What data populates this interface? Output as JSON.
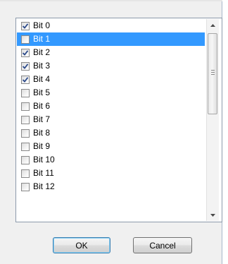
{
  "list": {
    "items": [
      {
        "label": "Bit 0",
        "checked": true,
        "selected": false
      },
      {
        "label": "Bit 1",
        "checked": false,
        "selected": true
      },
      {
        "label": "Bit 2",
        "checked": true,
        "selected": false
      },
      {
        "label": "Bit 3",
        "checked": true,
        "selected": false
      },
      {
        "label": "Bit 4",
        "checked": true,
        "selected": false
      },
      {
        "label": "Bit 5",
        "checked": false,
        "selected": false
      },
      {
        "label": "Bit 6",
        "checked": false,
        "selected": false
      },
      {
        "label": "Bit 7",
        "checked": false,
        "selected": false
      },
      {
        "label": "Bit 8",
        "checked": false,
        "selected": false
      },
      {
        "label": "Bit 9",
        "checked": false,
        "selected": false
      },
      {
        "label": "Bit 10",
        "checked": false,
        "selected": false
      },
      {
        "label": "Bit 11",
        "checked": false,
        "selected": false
      },
      {
        "label": "Bit 12",
        "checked": false,
        "selected": false
      }
    ]
  },
  "scrollbar": {
    "up_icon": "scroll-up-arrow-icon",
    "down_icon": "scroll-down-arrow-icon"
  },
  "buttons": {
    "ok_label": "OK",
    "cancel_label": "Cancel"
  },
  "colors": {
    "selection": "#3399ff",
    "check_mark": "#2c4a8a"
  }
}
